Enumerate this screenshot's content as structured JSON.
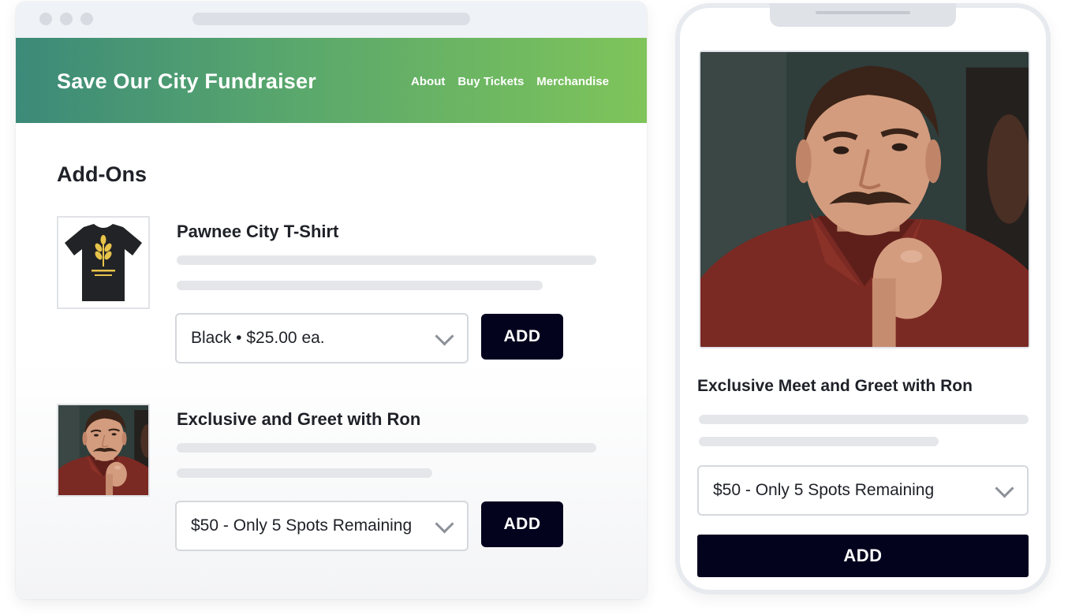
{
  "desktop": {
    "header": {
      "title": "Save Our City Fundraiser",
      "nav": [
        "About",
        "Buy Tickets",
        "Merchandise"
      ]
    },
    "section_title": "Add-Ons",
    "items": [
      {
        "title": "Pawnee City T-Shirt",
        "select_value": "Black • $25.00 ea.",
        "button": "ADD",
        "image": "black-tshirt-wheat-logo"
      },
      {
        "title": "Exclusive and Greet with Ron",
        "select_value": "$50 - Only 5 Spots Remaining",
        "button": "ADD",
        "image": "ron-portrait"
      }
    ]
  },
  "mobile": {
    "title": "Exclusive Meet and Greet with Ron",
    "select_value": "$50 - Only 5 Spots Remaining",
    "button": "ADD",
    "image": "ron-portrait"
  },
  "colors": {
    "header_gradient_start": "#3c8a79",
    "header_gradient_end": "#7fc45a",
    "button_bg": "#04031e",
    "logo_gold": "#e8c34a"
  },
  "icons": [
    "chevron-down-icon",
    "wheat-logo-icon"
  ]
}
